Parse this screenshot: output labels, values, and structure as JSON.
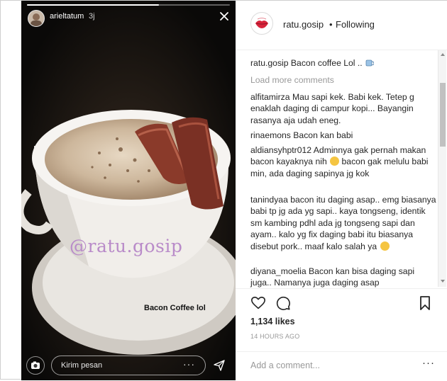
{
  "story": {
    "username": "arieltatum",
    "time": "3j",
    "watermark": "@ratu.gosip",
    "caption": "Bacon Coffee lol",
    "reply_placeholder": "Kirim pesan",
    "reply_more": "···",
    "progress_fraction": 0.65,
    "icons": [
      "close-icon",
      "camera-icon",
      "send-icon"
    ]
  },
  "post": {
    "account": "ratu.gosip",
    "separator": "•",
    "follow_state": "Following",
    "caption_user": "ratu.gosip",
    "caption_text": "Bacon coffee Lol ..",
    "load_more": "Load more comments",
    "comments": [
      {
        "user": "alfitamirza",
        "text": "Mau sapi kek. Babi kek. Tetep g enaklah daging di campur kopi... Bayangin rasanya aja udah eneg."
      },
      {
        "user": "rinaemons",
        "text": "Bacon kan babi"
      },
      {
        "user": "aldiansyhptr012",
        "text": "Adminnya gak pernah makan bacon kayaknya nih",
        "text2": " bacon gak melulu babi min, ada daging sapinya jg kok"
      },
      {
        "user": "tanindyaa",
        "text": "bacon itu daging asap.. emg biasanya babi tp jg ada yg sapi.. kaya tongseng, identik sm kambing pdhl ada jg tongseng sapi dan ayam.. kalo yg fix daging babi itu biasanya disebut pork.. maaf kalo salah ya"
      },
      {
        "user": "diyana_moelia",
        "text": "Bacon kan bisa daging sapi juga.. Namanya juga daging asap"
      }
    ],
    "likes": "1,134 likes",
    "timestamp": "14 HOURS AGO",
    "add_comment_placeholder": "Add a comment...",
    "more_options": "···",
    "icons": [
      "heart-icon",
      "comment-icon",
      "bookmark-icon"
    ]
  },
  "colors": {
    "watermark": "#b98bc9",
    "muted": "#999999",
    "text": "#262626"
  }
}
